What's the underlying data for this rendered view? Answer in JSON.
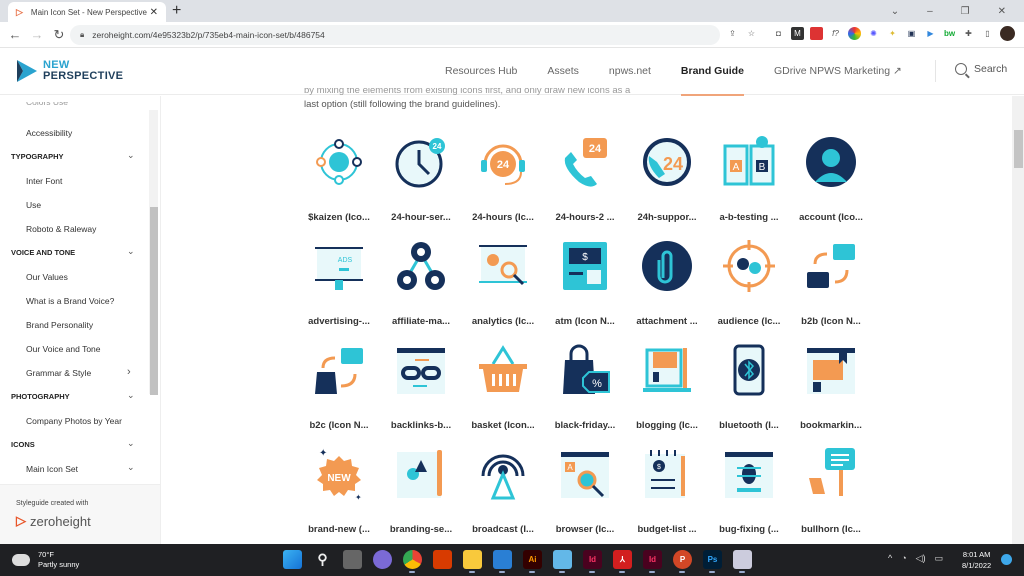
{
  "browser": {
    "tab_title": "Main Icon Set - New Perspective",
    "tab_favicon": "zeroheight-favicon",
    "url": "zeroheight.com/4e95323b2/p/735eb4-main-icon-set/b/486754",
    "window_controls": [
      "chevron-down-icon",
      "minimize-icon",
      "maximize-icon",
      "close-icon"
    ],
    "extension_icons": [
      "share-icon",
      "star-icon",
      "camera-icon",
      "m-extension-icon",
      "red-extension-icon",
      "formula-extension-icon",
      "color-wheel-icon",
      "gear-extension-icon",
      "bulb-extension-icon",
      "bus-extension-icon",
      "video-extension-icon",
      "bw-extension-icon",
      "puzzle-icon",
      "sidebar-icon",
      "profile-avatar",
      "more-menu-icon"
    ]
  },
  "site": {
    "logo_line1": "NEW",
    "logo_line2": "PERSPECTIVE",
    "nav": [
      {
        "label": "Resources Hub",
        "active": false
      },
      {
        "label": "Assets",
        "active": false
      },
      {
        "label": "npws.net",
        "active": false
      },
      {
        "label": "Brand Guide",
        "active": true
      },
      {
        "label": "GDrive NPWS Marketing ↗",
        "active": false
      }
    ],
    "search_label": "Search"
  },
  "sidebar": {
    "cut_off_item": "Colors Use",
    "entries": [
      {
        "type": "item",
        "label": "Accessibility"
      },
      {
        "type": "section",
        "label": "TYPOGRAPHY",
        "chevron": "⌄"
      },
      {
        "type": "item",
        "label": "Inter Font"
      },
      {
        "type": "item",
        "label": "Use"
      },
      {
        "type": "item",
        "label": "Roboto & Raleway"
      },
      {
        "type": "section",
        "label": "VOICE AND TONE",
        "chevron": "⌄"
      },
      {
        "type": "item",
        "label": "Our Values"
      },
      {
        "type": "item",
        "label": "What is a Brand Voice?"
      },
      {
        "type": "item",
        "label": "Brand Personality"
      },
      {
        "type": "item",
        "label": "Our Voice and Tone"
      },
      {
        "type": "item",
        "label": "Grammar & Style",
        "chevron": "›"
      },
      {
        "type": "section",
        "label": "PHOTOGRAPHY",
        "chevron": "⌄"
      },
      {
        "type": "item",
        "label": "Company Photos by Year"
      },
      {
        "type": "section",
        "label": "ICONS",
        "chevron": "⌄"
      },
      {
        "type": "item",
        "label": "Main Icon Set",
        "chevron": "⌄"
      }
    ],
    "footer_caption": "Styleguide created with",
    "footer_brand": "zeroheight"
  },
  "content": {
    "intro_line1": "by mixing the elements from existing icons first, and only draw new icons as a",
    "intro_line2": "last option (still following the brand guidelines).",
    "icons": [
      {
        "label": "$kaizen (Ico...",
        "icon": "kaizen-cycle-icon"
      },
      {
        "label": "24-hour-ser...",
        "icon": "clock-24-icon"
      },
      {
        "label": "24-hours (Ic...",
        "icon": "headset-24-icon"
      },
      {
        "label": "24-hours-2 ...",
        "icon": "phone-24-icon"
      },
      {
        "label": "24h-suppor...",
        "icon": "support-24-icon"
      },
      {
        "label": "a-b-testing ...",
        "icon": "ab-testing-icon"
      },
      {
        "label": "account (Ico...",
        "icon": "account-icon"
      },
      {
        "label": "advertising-...",
        "icon": "billboard-ads-icon"
      },
      {
        "label": "affiliate-ma...",
        "icon": "affiliate-network-icon"
      },
      {
        "label": "analytics (Ic...",
        "icon": "analytics-icon"
      },
      {
        "label": "atm (Icon N...",
        "icon": "atm-icon"
      },
      {
        "label": "attachment ...",
        "icon": "paperclip-icon"
      },
      {
        "label": "audience (Ic...",
        "icon": "audience-target-icon"
      },
      {
        "label": "b2b (Icon N...",
        "icon": "b2b-briefcase-icon"
      },
      {
        "label": "b2c (Icon N...",
        "icon": "b2c-bag-icon"
      },
      {
        "label": "backlinks-b...",
        "icon": "backlinks-icon"
      },
      {
        "label": "basket (Icon...",
        "icon": "basket-icon"
      },
      {
        "label": "black-friday...",
        "icon": "shopping-bag-percent-icon"
      },
      {
        "label": "blogging (Ic...",
        "icon": "blogging-laptop-icon"
      },
      {
        "label": "bluetooth (I...",
        "icon": "bluetooth-phone-icon"
      },
      {
        "label": "bookmarkin...",
        "icon": "bookmark-icon"
      },
      {
        "label": "brand-new (...",
        "icon": "new-badge-icon"
      },
      {
        "label": "branding-se...",
        "icon": "branding-shapes-icon"
      },
      {
        "label": "broadcast (I...",
        "icon": "broadcast-tower-icon"
      },
      {
        "label": "browser (Ic...",
        "icon": "browser-search-icon"
      },
      {
        "label": "budget-list ...",
        "icon": "budget-list-icon"
      },
      {
        "label": "bug-fixing (...",
        "icon": "bug-fixing-icon"
      },
      {
        "label": "bullhorn (Ic...",
        "icon": "bullhorn-icon"
      }
    ]
  },
  "colors": {
    "teal": "#2ec4d6",
    "navy": "#15305a",
    "orange": "#f39a52",
    "light": "#e8f8fa",
    "accent_underline": "#f0a47a"
  },
  "taskbar": {
    "weather_temp": "70°F",
    "weather_desc": "Partly sunny",
    "apps": [
      "windows-start",
      "search",
      "task-view",
      "teams-chat",
      "chrome",
      "office",
      "file-explorer",
      "photos",
      "illustrator",
      "notepad",
      "indesign",
      "acrobat",
      "indesign-2",
      "powerpoint",
      "photoshop",
      "snipping-tool"
    ],
    "time": "8:01 AM",
    "date": "8/1/2022"
  }
}
